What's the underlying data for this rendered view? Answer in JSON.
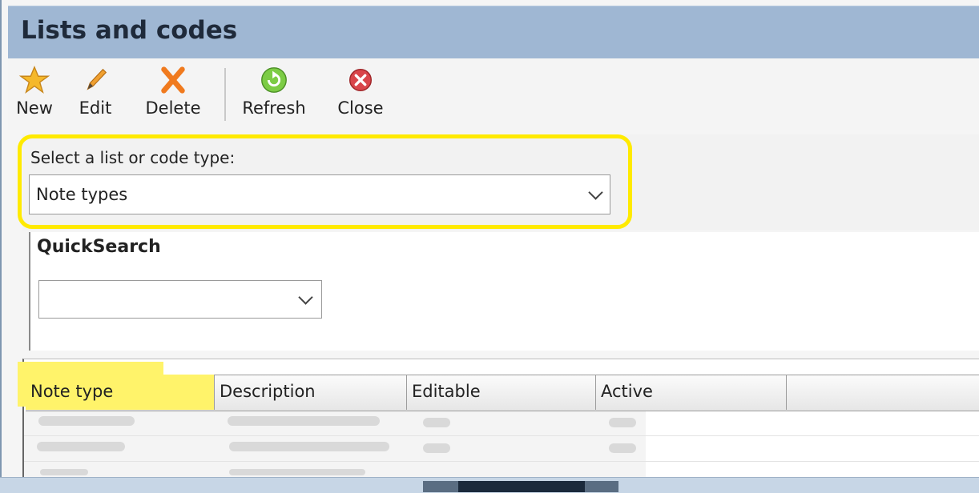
{
  "window": {
    "title": "Lists and codes"
  },
  "toolbar": {
    "buttons": [
      {
        "label": "New",
        "icon": "star-icon"
      },
      {
        "label": "Edit",
        "icon": "pencil-icon"
      },
      {
        "label": "Delete",
        "icon": "delete-x-icon"
      },
      {
        "label": "Refresh",
        "icon": "refresh-icon"
      },
      {
        "label": "Close",
        "icon": "close-circle-icon"
      }
    ]
  },
  "list_selector": {
    "label": "Select a list or code type:",
    "value": "Note types"
  },
  "quicksearch": {
    "title": "QuickSearch",
    "value": ""
  },
  "grid": {
    "columns": [
      "Note type",
      "Description",
      "Editable",
      "Active"
    ]
  },
  "colors": {
    "titlebar": "#9fb7d3",
    "highlight": "#ffea00",
    "column_highlight": "#fff36a"
  }
}
